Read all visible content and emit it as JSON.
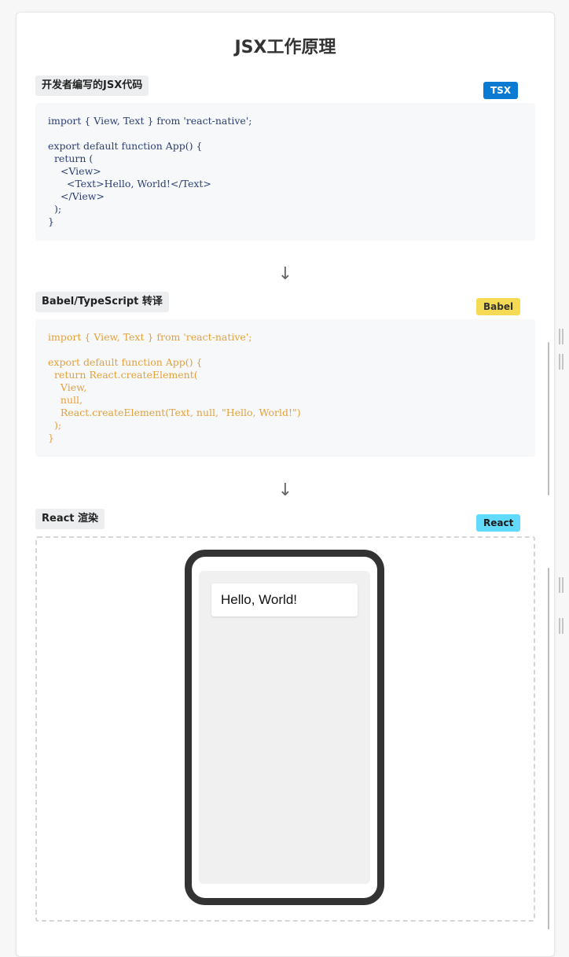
{
  "page": {
    "title": "JSX工作原理"
  },
  "sections": [
    {
      "label": "开发者编写的JSX代码",
      "badge": "TSX",
      "badge_color": "#0a7ad2",
      "code_color": "#2c3e73",
      "code": "import { View, Text } from 'react-native';\n\nexport default function App() {\n  return (\n    <View>\n      <Text>Hello, World!</Text>\n    </View>\n  );\n}"
    },
    {
      "label": "Babel/TypeScript 转译",
      "badge": "Babel",
      "badge_color": "#f5da55",
      "code_color": "#e5a03a",
      "code": "import { View, Text } from 'react-native';\n\nexport default function App() {\n  return React.createElement(\n    View,\n    null,\n    React.createElement(Text, null, \"Hello, World!\")\n  );\n}"
    },
    {
      "label": "React 渲染",
      "badge": "React",
      "badge_color": "#61dafb"
    }
  ],
  "arrows": [
    "↓",
    "↓"
  ],
  "preview": {
    "text": "Hello, World!"
  }
}
